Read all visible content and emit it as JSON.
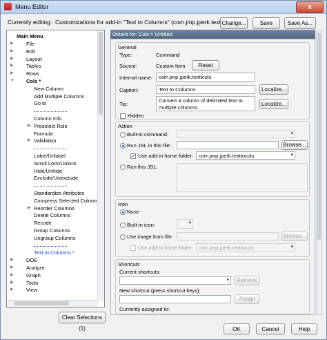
{
  "window": {
    "title": "Menu Editor",
    "close": "x"
  },
  "editing": {
    "label": "Currently editing:",
    "value": "Customizations for add-in \"Text to Columns\" (com.jmp.jperk.texttocols)"
  },
  "top_buttons": {
    "change": "Change...",
    "save": "Save",
    "save_as": "Save As..."
  },
  "tree": {
    "root": "Main Menu",
    "items": [
      {
        "label": "File",
        "level": 1,
        "expander": "▶"
      },
      {
        "label": "Edit",
        "level": 1,
        "expander": "▶"
      },
      {
        "label": "Layout",
        "level": 1,
        "expander": "▶"
      },
      {
        "label": "Tables",
        "level": 1,
        "expander": "▶"
      },
      {
        "label": "Rows",
        "level": 1,
        "expander": "▶"
      },
      {
        "label": "Cols *",
        "level": 1,
        "expander": "▼",
        "bold": true
      },
      {
        "label": "New Column",
        "level": 2
      },
      {
        "label": "Add Multiple Columns",
        "level": 2
      },
      {
        "label": "Go to",
        "level": 2
      },
      {
        "label": "sep",
        "level": 2
      },
      {
        "label": "Column Info",
        "level": 2
      },
      {
        "label": "Preselect Role",
        "level": 2,
        "expander": "▶"
      },
      {
        "label": "Formula",
        "level": 2
      },
      {
        "label": "Validation",
        "level": 2,
        "expander": "▶"
      },
      {
        "label": "sep",
        "level": 2
      },
      {
        "label": "Label/Unlabel",
        "level": 2
      },
      {
        "label": "Scroll Lock/Unlock",
        "level": 2
      },
      {
        "label": "Hide/Unhide",
        "level": 2
      },
      {
        "label": "Exclude/Unexclude",
        "level": 2
      },
      {
        "label": "sep",
        "level": 2
      },
      {
        "label": "Standardize Attributes",
        "level": 2
      },
      {
        "label": "Compress Selected Columns",
        "level": 2
      },
      {
        "label": "Reorder Columns",
        "level": 2,
        "expander": "▶"
      },
      {
        "label": "Delete Columns",
        "level": 2
      },
      {
        "label": "Recode",
        "level": 2
      },
      {
        "label": "Group Columns",
        "level": 2
      },
      {
        "label": "Ungroup Columns",
        "level": 2
      },
      {
        "label": "sep",
        "level": 2,
        "blue": true
      },
      {
        "label": "Text to Columns *",
        "level": 2,
        "selected": true
      },
      {
        "label": "DOE",
        "level": 1,
        "expander": "▶"
      },
      {
        "label": "Analyze",
        "level": 1,
        "expander": "▶"
      },
      {
        "label": "Graph",
        "level": 1,
        "expander": "▶"
      },
      {
        "label": "Tools",
        "level": 1,
        "expander": "▶"
      },
      {
        "label": "View",
        "level": 1,
        "expander": "▶"
      }
    ],
    "clear_button": "Clear Selections (1)"
  },
  "details": {
    "header": "Details for:  Cols > Untitled",
    "general": {
      "title": "General",
      "type_label": "Type:",
      "type_value": "Command",
      "source_label": "Source:",
      "source_value": "Custom Item",
      "reset": "Reset",
      "internal_label": "Internal name:",
      "internal_value": "com.jmp.jperk.texttcols",
      "caption_label": "Caption:",
      "caption_value": "Text to Columns",
      "localize1": "Localize...",
      "tip_label": "Tip:",
      "tip_value": "Convert a column of delimited text to multiple columns.",
      "localize2": "Localize...",
      "hidden_label": "Hidden"
    },
    "action": {
      "title": "Action",
      "builtin_label": "Built-in command:",
      "runjsl_file_label": "Run JSL in this file:",
      "browse": "Browse...",
      "use_home_label": "Use add-in home folder:",
      "home_value": "com.jmp.jperk.texttocols",
      "runjsl_label": "Run this JSL:"
    },
    "icon": {
      "title": "Icon",
      "none_label": "None",
      "builtin_label": "Built-in icon:",
      "image_label": "Use image from file:",
      "browse": "Browse...",
      "use_home_label": "Use add-in home folder:",
      "home_value": "com.jmp.jperk.texttocols"
    },
    "shortcuts": {
      "title": "Shortcuts",
      "current_label": "Current shortcuts:",
      "remove": "Remove",
      "new_label": "New shortcut (press shortcut keys):",
      "assign": "Assign",
      "assigned_label": "Currently assigned to:"
    }
  },
  "bottom_buttons": {
    "ok": "OK",
    "cancel": "Cancel",
    "help": "Help"
  }
}
